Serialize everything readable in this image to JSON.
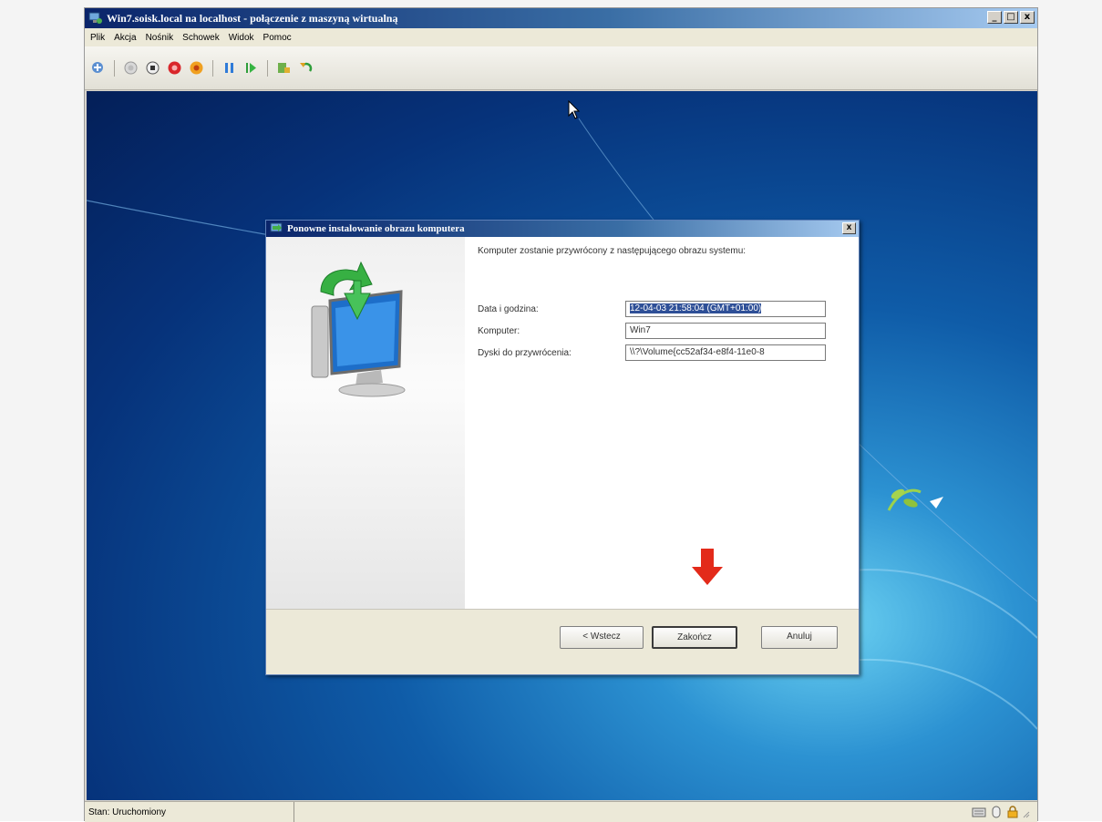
{
  "window": {
    "title": "Win7.soisk.local na localhost - połączenie z maszyną wirtualną",
    "controls": {
      "minimize": "_",
      "maximize": "□",
      "close": "x"
    }
  },
  "menu": [
    "Plik",
    "Akcja",
    "Nośnik",
    "Schowek",
    "Widok",
    "Pomoc"
  ],
  "toolbar": {
    "icons": [
      "ctrl-alt-del-icon",
      "start-icon",
      "turn-off-icon",
      "shutdown-icon",
      "reset-icon",
      "pause-icon",
      "resume-icon",
      "snapshot-icon",
      "revert-icon"
    ]
  },
  "dialog": {
    "title": "Ponowne instalowanie obrazu komputera",
    "close": "x",
    "intro": "Komputer zostanie przywrócony z następującego obrazu systemu:",
    "rows": [
      {
        "label": "Data i godzina:",
        "value": "12-04-03 21:58:04 (GMT+01:00)"
      },
      {
        "label": "Komputer:",
        "value": "Win7"
      },
      {
        "label": "Dyski do przywrócenia:",
        "value": "\\\\?\\Volume{cc52af34-e8f4-11e0-8"
      }
    ],
    "buttons": {
      "back": "< Wstecz",
      "finish": "Zakończ",
      "cancel": "Anuluj"
    }
  },
  "status": {
    "text": "Stan: Uruchomiony"
  },
  "colors": {
    "titlebar": "#0a246a",
    "accent_red": "#e32a1a",
    "desktop": "#0f5ca8"
  }
}
